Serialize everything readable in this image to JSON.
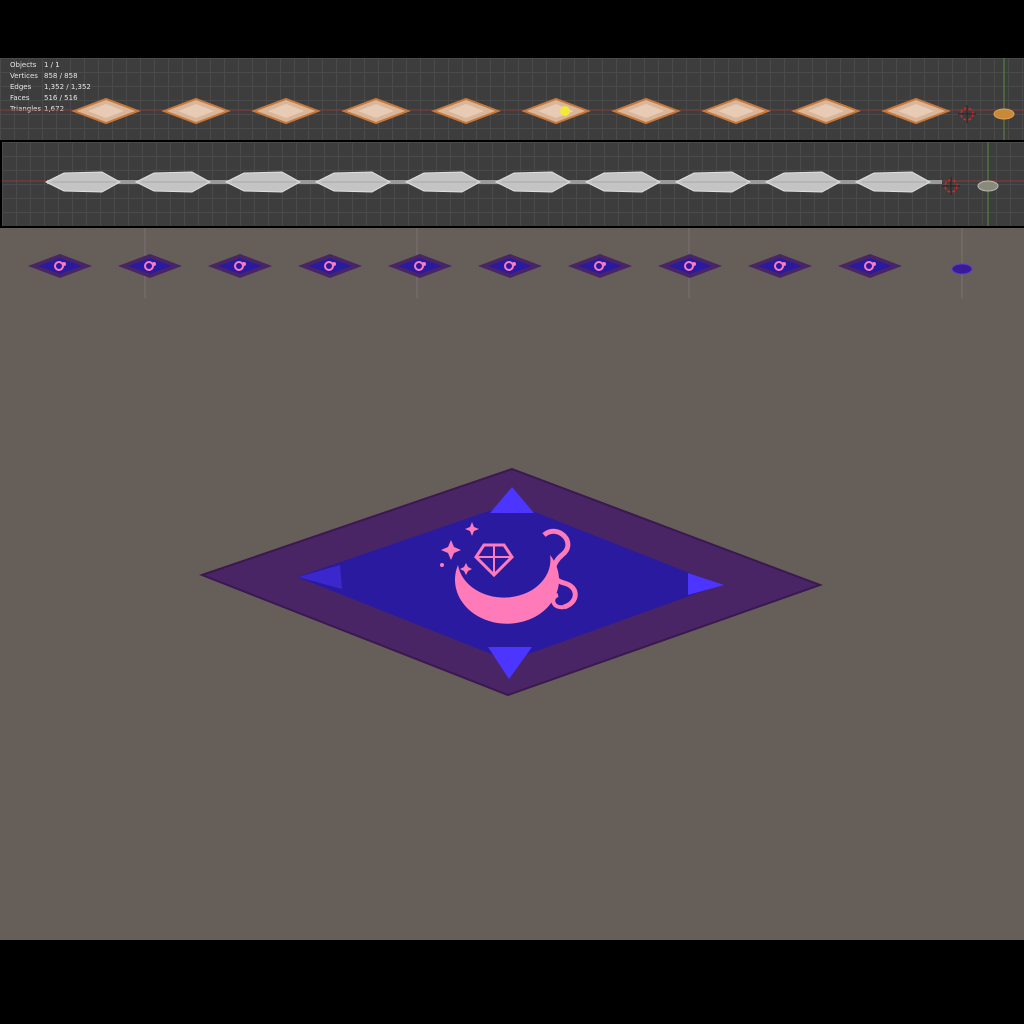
{
  "stats_overlay": {
    "rows": [
      {
        "label": "Objects",
        "value": "1 / 1"
      },
      {
        "label": "Vertices",
        "value": "858 / 858"
      },
      {
        "label": "Edges",
        "value": "1,352 / 1,352"
      },
      {
        "label": "Faces",
        "value": "516 / 516"
      },
      {
        "label": "Triangles",
        "value": "1,672"
      }
    ]
  },
  "colors": {
    "viewport_grid_bg": "#3d3d3d",
    "main_viewport_bg": "#665e58",
    "selected_tile": "#d9b69a",
    "tile_frame": "#4a2566",
    "tile_inner": "#2a1aa0",
    "emblem_pink": "#ff7ab8"
  },
  "icons": {
    "camera": "camera-icon",
    "cursor": "3d-cursor-icon",
    "light": "light-icon",
    "emblem": "moon-gem-emblem-icon"
  }
}
